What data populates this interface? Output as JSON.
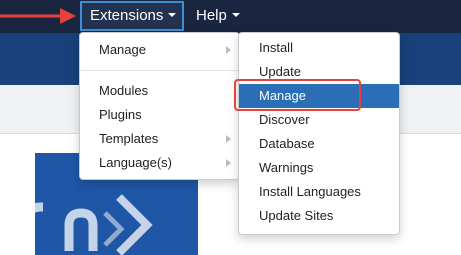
{
  "topnav": {
    "extensions_label": "Extensions",
    "help_label": "Help"
  },
  "extensions_menu": {
    "items": [
      {
        "label": "Manage",
        "has_submenu": true
      },
      {
        "label": "Modules",
        "has_submenu": false
      },
      {
        "label": "Plugins",
        "has_submenu": false
      },
      {
        "label": "Templates",
        "has_submenu": true
      },
      {
        "label": "Language(s)",
        "has_submenu": true
      }
    ]
  },
  "manage_submenu": {
    "items": [
      {
        "label": "Install"
      },
      {
        "label": "Update"
      },
      {
        "label": "Manage",
        "highlighted": true
      },
      {
        "label": "Discover"
      },
      {
        "label": "Database"
      },
      {
        "label": "Warnings"
      },
      {
        "label": "Install Languages"
      },
      {
        "label": "Update Sites"
      }
    ]
  },
  "colors": {
    "topbar": "#1a2540",
    "accent_blue": "#2a6fb5",
    "callout_red": "#e8413d"
  },
  "icons": [
    "caret-down-icon",
    "chevron-right-icon",
    "red-arrow-icon",
    "logo-chevron-icon"
  ]
}
